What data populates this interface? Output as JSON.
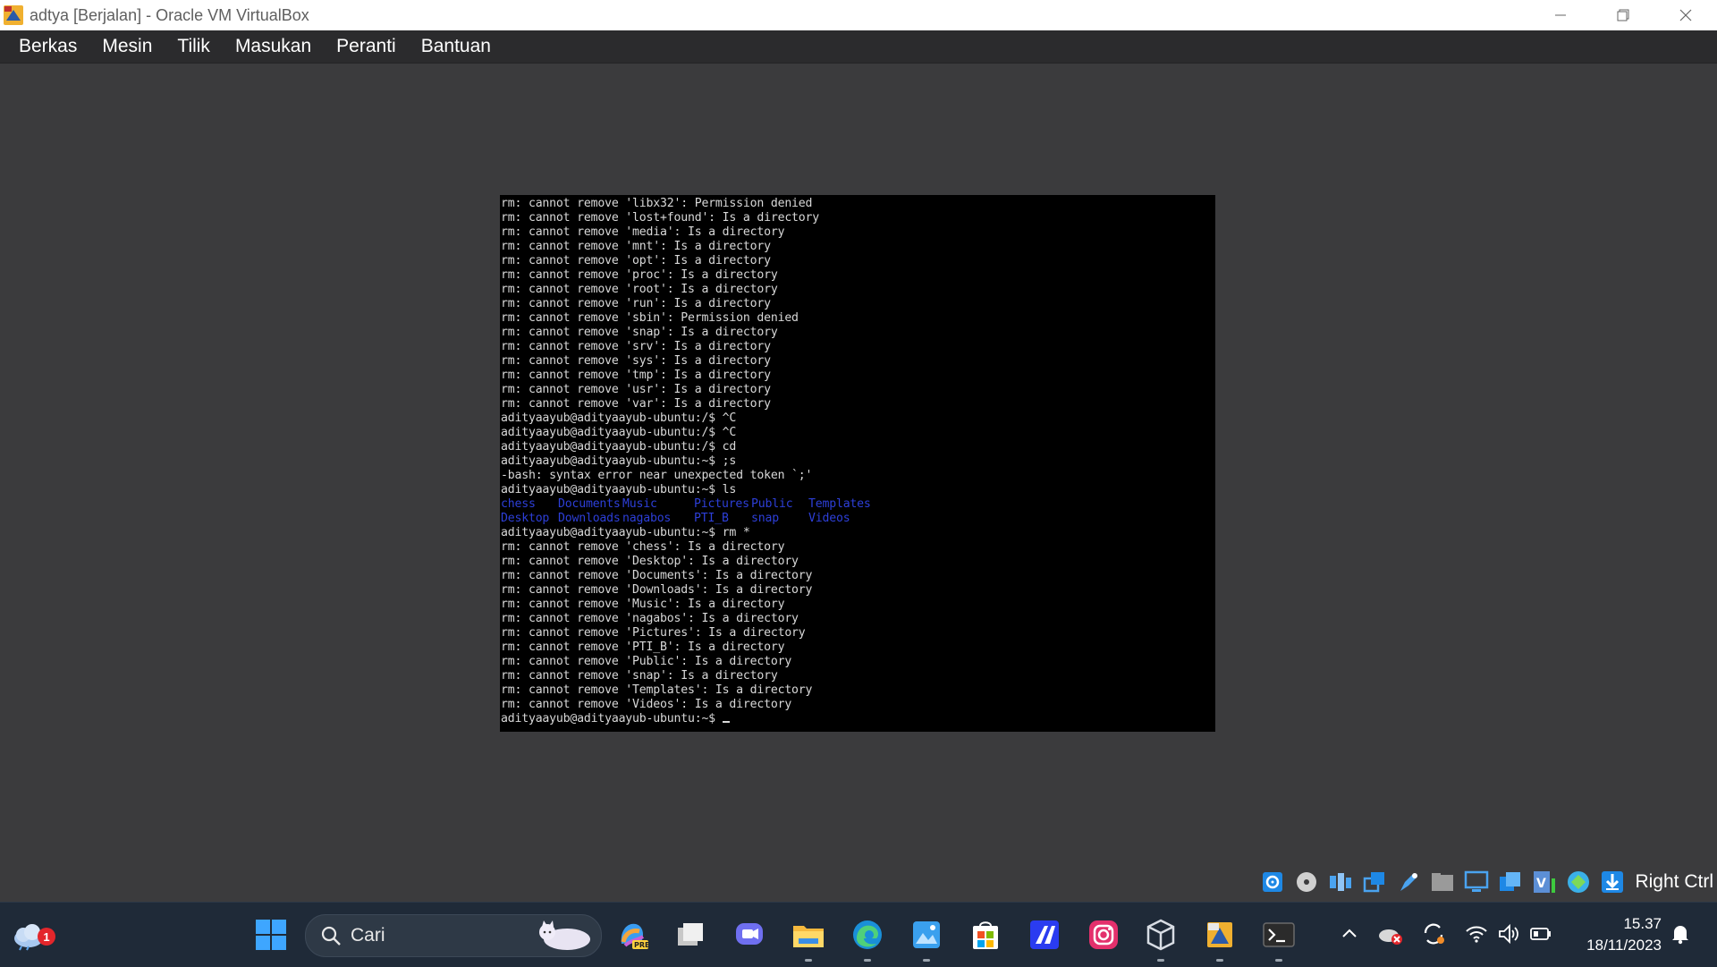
{
  "window": {
    "title": "adtya [Berjalan] - Oracle VM VirtualBox"
  },
  "menu": [
    "Berkas",
    "Mesin",
    "Tilik",
    "Masukan",
    "Peranti",
    "Bantuan"
  ],
  "terminal": {
    "lines_top": [
      "rm: cannot remove 'libx32': Permission denied",
      "rm: cannot remove 'lost+found': Is a directory",
      "rm: cannot remove 'media': Is a directory",
      "rm: cannot remove 'mnt': Is a directory",
      "rm: cannot remove 'opt': Is a directory",
      "rm: cannot remove 'proc': Is a directory",
      "rm: cannot remove 'root': Is a directory",
      "rm: cannot remove 'run': Is a directory",
      "rm: cannot remove 'sbin': Permission denied",
      "rm: cannot remove 'snap': Is a directory",
      "rm: cannot remove 'srv': Is a directory",
      "rm: cannot remove 'sys': Is a directory",
      "rm: cannot remove 'tmp': Is a directory",
      "rm: cannot remove 'usr': Is a directory",
      "rm: cannot remove 'var': Is a directory",
      "adityaayub@adityaayub-ubuntu:/$ ^C",
      "adityaayub@adityaayub-ubuntu:/$ ^C",
      "adityaayub@adityaayub-ubuntu:/$ cd",
      "adityaayub@adityaayub-ubuntu:~$ ;s",
      "-bash: syntax error near unexpected token `;'",
      "adityaayub@adityaayub-ubuntu:~$ ls"
    ],
    "ls_rows": [
      [
        "chess",
        "Documents",
        "Music",
        "Pictures",
        "Public",
        "Templates"
      ],
      [
        "Desktop",
        "Downloads",
        "nagabos",
        "PTI_B",
        "snap",
        "Videos"
      ]
    ],
    "lines_bottom": [
      "adityaayub@adityaayub-ubuntu:~$ rm *",
      "rm: cannot remove 'chess': Is a directory",
      "rm: cannot remove 'Desktop': Is a directory",
      "rm: cannot remove 'Documents': Is a directory",
      "rm: cannot remove 'Downloads': Is a directory",
      "rm: cannot remove 'Music': Is a directory",
      "rm: cannot remove 'nagabos': Is a directory",
      "rm: cannot remove 'Pictures': Is a directory",
      "rm: cannot remove 'PTI_B': Is a directory",
      "rm: cannot remove 'Public': Is a directory",
      "rm: cannot remove 'snap': Is a directory",
      "rm: cannot remove 'Templates': Is a directory",
      "rm: cannot remove 'Videos': Is a directory"
    ],
    "prompt": "adityaayub@adityaayub-ubuntu:~$ ",
    "colors": {
      "background": "#000000",
      "foreground": "#d8d8d8",
      "directory": "#2d3fd8"
    }
  },
  "statusbar": {
    "icons": [
      "hard-disk-icon",
      "optical-disk-icon",
      "audio-icon",
      "network-icon",
      "usb-icon",
      "shared-folder-icon",
      "display-icon",
      "recording-icon",
      "cpu-icon",
      "mouse-integration-icon",
      "keyboard-download-icon"
    ],
    "host_key": "Right Ctrl"
  },
  "taskbar": {
    "weather_badge": "1",
    "search_placeholder": "Cari",
    "apps": [
      "start-icon",
      "copilot-icon",
      "task-view-icon",
      "chat-icon",
      "file-explorer-icon",
      "edge-icon",
      "photos-icon",
      "store-icon",
      "app-ai-icon",
      "instagram-icon",
      "virtualbox-icon",
      "virtualbox-vm-icon",
      "terminal-icon"
    ],
    "clock": {
      "time": "15.37",
      "date": "18/11/2023"
    }
  }
}
